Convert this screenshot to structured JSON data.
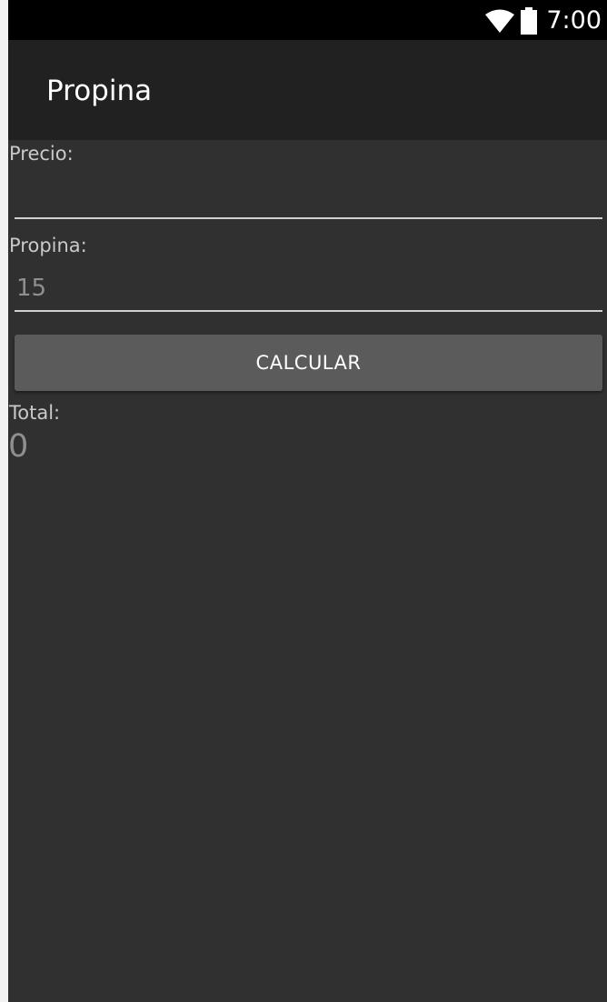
{
  "status_bar": {
    "time": "7:00",
    "icons": [
      "wifi-icon",
      "battery-icon"
    ]
  },
  "app_bar": {
    "title": "Propina"
  },
  "form": {
    "precio_label": "Precio:",
    "precio_value": "",
    "propina_label": "Propina:",
    "propina_value": "15",
    "calculate_label": "CALCULAR",
    "total_label": "Total:",
    "total_value": "0"
  },
  "colors": {
    "status_bar": "#000000",
    "app_bar": "#212121",
    "background": "#303030",
    "button": "#5b5b5c",
    "text_primary": "#ffffff",
    "text_secondary": "#c9c9c9",
    "text_value": "#8f8f8f"
  }
}
